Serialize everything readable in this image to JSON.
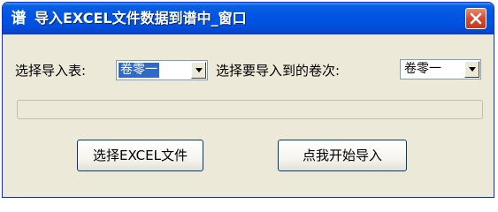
{
  "window": {
    "title": "导入EXCEL文件数据到谱中_窗口",
    "icon_glyph": "谱",
    "icon": "app-icon",
    "close_icon": "close-icon"
  },
  "form": {
    "select_table_label": "选择导入表:",
    "select_table_value": "卷零一",
    "target_volume_label": "选择要导入到的卷次:",
    "target_volume_value": "卷零一",
    "progress": 0
  },
  "buttons": {
    "choose_file": "选择EXCEL文件",
    "start_import": "点我开始导入"
  },
  "colors": {
    "titlebar": "#0054e3",
    "window_bg": "#ece9d8",
    "selection": "#316ac5",
    "close_button": "#d9482a"
  }
}
